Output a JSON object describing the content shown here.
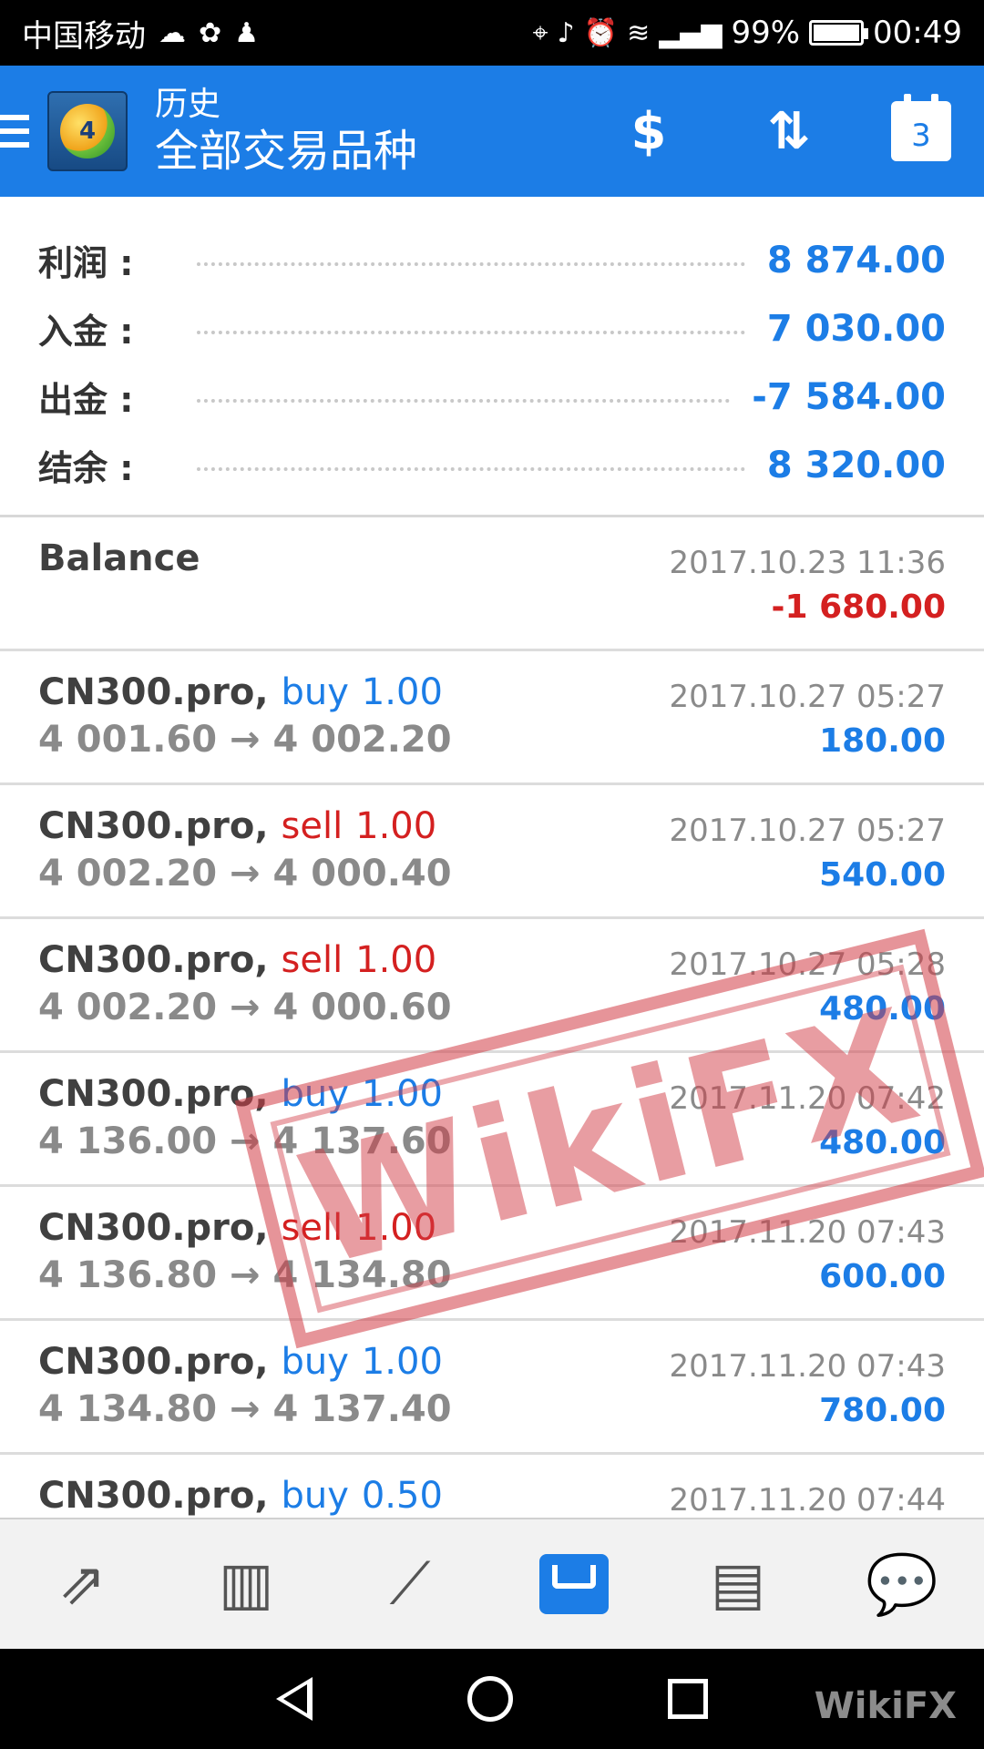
{
  "status_bar": {
    "carrier": "中国移动",
    "battery": "99%",
    "time": "00:49"
  },
  "app_bar": {
    "subtitle": "历史",
    "title": "全部交易品种",
    "calendar_day": "3"
  },
  "summary": [
    {
      "label": "利润 :",
      "value": "8 874.00"
    },
    {
      "label": "入金 :",
      "value": "7 030.00"
    },
    {
      "label": "出金 :",
      "value": "-7 584.00"
    },
    {
      "label": "结余 :",
      "value": "8 320.00"
    }
  ],
  "entries": [
    {
      "symbol": "Balance",
      "side": "",
      "lots": "",
      "prices": "",
      "time": "2017.10.23 11:36",
      "profit": "-1 680.00",
      "profit_sign": "neg"
    },
    {
      "symbol": "CN300.pro,",
      "side": "buy",
      "lots": "1.00",
      "prices": "4 001.60 → 4 002.20",
      "time": "2017.10.27 05:27",
      "profit": "180.00",
      "profit_sign": "pos"
    },
    {
      "symbol": "CN300.pro,",
      "side": "sell",
      "lots": "1.00",
      "prices": "4 002.20 → 4 000.40",
      "time": "2017.10.27 05:27",
      "profit": "540.00",
      "profit_sign": "pos"
    },
    {
      "symbol": "CN300.pro,",
      "side": "sell",
      "lots": "1.00",
      "prices": "4 002.20 → 4 000.60",
      "time": "2017.10.27 05:28",
      "profit": "480.00",
      "profit_sign": "pos"
    },
    {
      "symbol": "CN300.pro,",
      "side": "buy",
      "lots": "1.00",
      "prices": "4 136.00 → 4 137.60",
      "time": "2017.11.20 07:42",
      "profit": "480.00",
      "profit_sign": "pos"
    },
    {
      "symbol": "CN300.pro,",
      "side": "sell",
      "lots": "1.00",
      "prices": "4 136.80 → 4 134.80",
      "time": "2017.11.20 07:43",
      "profit": "600.00",
      "profit_sign": "pos"
    },
    {
      "symbol": "CN300.pro,",
      "side": "buy",
      "lots": "1.00",
      "prices": "4 134.80 → 4 137.40",
      "time": "2017.11.20 07:43",
      "profit": "780.00",
      "profit_sign": "pos"
    },
    {
      "symbol": "CN300.pro,",
      "side": "buy",
      "lots": "0.50",
      "prices": "",
      "time": "2017.11.20 07:44",
      "profit": "",
      "profit_sign": "pos"
    }
  ],
  "watermark": {
    "stamp_text": "WikiFX",
    "corner_text": "WikiFX"
  },
  "colors": {
    "accent": "#1c7de6",
    "loss": "#d42020"
  }
}
